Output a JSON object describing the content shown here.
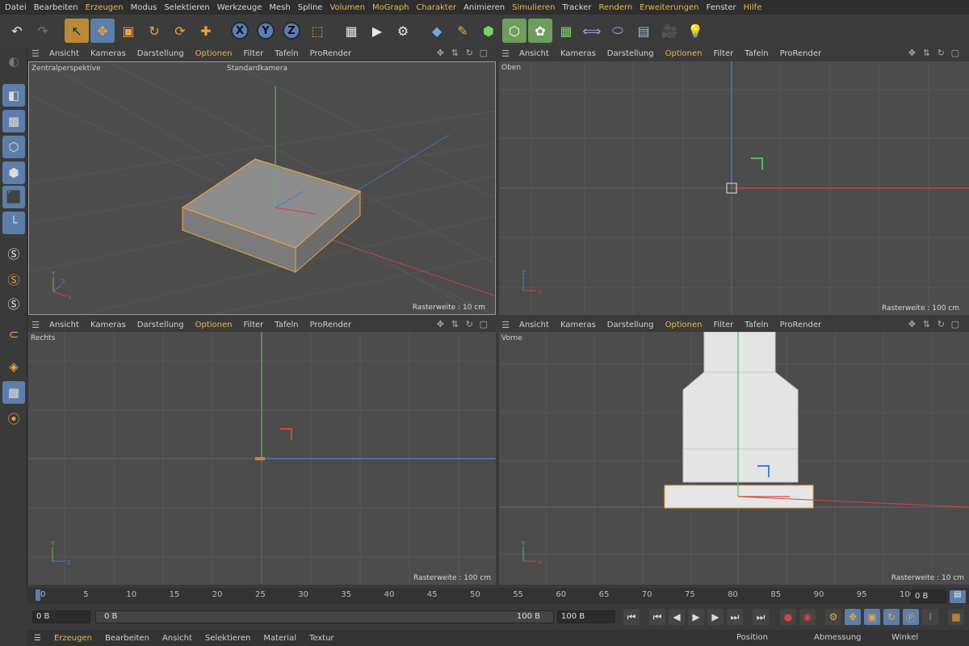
{
  "menubar": [
    "Datei",
    "Bearbeiten",
    "Erzeugen",
    "Modus",
    "Selektieren",
    "Werkzeuge",
    "Mesh",
    "Spline",
    "Volumen",
    "MoGraph",
    "Charakter",
    "Animieren",
    "Simulieren",
    "Tracker",
    "Rendern",
    "Erweiterungen",
    "Fenster",
    "Hilfe"
  ],
  "menubar_highlight": [
    "Erzeugen",
    "Volumen",
    "MoGraph",
    "Charakter",
    "Simulieren",
    "Rendern",
    "Erweiterungen",
    "Hilfe"
  ],
  "toolbar": {
    "undo_icon": "↶",
    "redo_icon": "↷",
    "select_icon": "↖",
    "move_icon": "✥",
    "scale_icon": "▣",
    "rotate_icon": "↻",
    "psr_icon": "⟳",
    "add_icon": "✚",
    "axis_x": "X",
    "axis_y": "Y",
    "axis_z": "Z",
    "coord_icon": "⬚",
    "clapper_icon": "▦",
    "render_view_icon": "▶",
    "render_settings_icon": "⚙",
    "cube_icon": "◆",
    "pen_icon": "✎",
    "subdiv_icon": "⬢",
    "array_icon": "⬡",
    "gear_green_icon": "✿",
    "cubes_icon": "▦",
    "deformer_icon": "⟺",
    "capsule_icon": "⬭",
    "floor_icon": "▤",
    "camera_icon": "🎥",
    "light_icon": "💡"
  },
  "viewports": [
    {
      "menu": [
        "Ansicht",
        "Kameras",
        "Darstellung",
        "Optionen",
        "Filter",
        "Tafeln",
        "ProRender"
      ],
      "label": "Zentralperspektive",
      "camera": "Standardkamera",
      "grid": "Rasterweite : 10 cm"
    },
    {
      "menu": [
        "Ansicht",
        "Kameras",
        "Darstellung",
        "Optionen",
        "Filter",
        "Tafeln",
        "ProRender"
      ],
      "label": "Oben",
      "grid": "Rasterweite : 100 cm"
    },
    {
      "menu": [
        "Ansicht",
        "Kameras",
        "Darstellung",
        "Optionen",
        "Filter",
        "Tafeln",
        "ProRender"
      ],
      "label": "Rechts",
      "grid": "Rasterweite : 100 cm"
    },
    {
      "menu": [
        "Ansicht",
        "Kameras",
        "Darstellung",
        "Optionen",
        "Filter",
        "Tafeln",
        "ProRender"
      ],
      "label": "Vorne",
      "grid": "Rasterweite : 10 cm"
    }
  ],
  "viewport_highlight": "Optionen",
  "timeline": {
    "ticks": [
      "0",
      "5",
      "10",
      "15",
      "20",
      "25",
      "30",
      "35",
      "40",
      "45",
      "50",
      "55",
      "60",
      "65",
      "70",
      "75",
      "80",
      "85",
      "90",
      "95",
      "100"
    ],
    "current_frame_field": "0 B"
  },
  "transport": {
    "start_field": "0 B",
    "current_field": "0 B",
    "end_field": "100 B",
    "max_field": "100 B"
  },
  "material_menu": [
    "Erzeugen",
    "Bearbeiten",
    "Ansicht",
    "Selektieren",
    "Material",
    "Textur"
  ],
  "attributes": {
    "position": "Position",
    "size": "Abmessung",
    "angle": "Winkel"
  },
  "axis_colors": {
    "x": "#d9453f",
    "y": "#4fc15a",
    "z": "#4a7fd9"
  }
}
